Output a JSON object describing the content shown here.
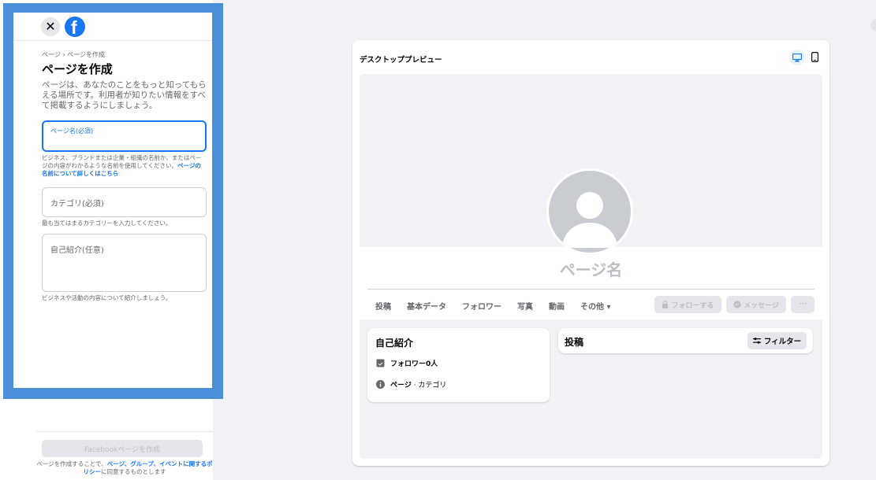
{
  "left_panel": {
    "close_glyph": "✕",
    "logo_letter": "f",
    "breadcrumb": "ページ › ページを作成",
    "title": "ページを作成",
    "description": "ページは、あなたのことをもっと知ってもらえる場所です。利用者が知りたい情報をすべて掲載するようにしましょう。",
    "page_name_field": {
      "label": "ページ名(必須)",
      "value": ""
    },
    "page_name_help": "ビジネス、ブランドまたは企業・組織の名前か、またはページの内容がわかるような名前を使用してください。",
    "page_name_help_link": "ページの名前について詳しくはこちら",
    "category_field": {
      "placeholder": "カテゴリ(必須)"
    },
    "category_help": "最も当てはまるカテゴリーを入力してください。",
    "bio_field": {
      "placeholder": "自己紹介(任意)"
    },
    "bio_help": "ビジネスや活動の内容について紹介しましょう。",
    "create_button": "Facebookページを作成",
    "terms_prefix": "ページを作成することで、",
    "terms_link": "ページ、グループ、イベントに関するポリシー",
    "terms_suffix": "に同意するものとします"
  },
  "preview": {
    "title": "デスクトッププレビュー",
    "page_name": "ページ名",
    "tabs": [
      "投稿",
      "基本データ",
      "フォロワー",
      "写真",
      "動画",
      "その他 ▾"
    ],
    "follow_button": "フォローする",
    "message_button": "メッセージ",
    "more_button": "···",
    "about": {
      "title": "自己紹介",
      "followers": "フォロワー0人",
      "info_bold": "ページ",
      "info_rest": " · カテゴリ"
    },
    "posts": {
      "title": "投稿",
      "filter_button": "フィルター"
    }
  },
  "colors": {
    "accent": "#1877f2",
    "highlight_border": "#4a90d9",
    "disabled_text": "#bcc0c4"
  },
  "icons": [
    "close-icon",
    "facebook-logo-icon",
    "desktop-icon",
    "mobile-icon",
    "lock-icon",
    "messenger-icon",
    "follower-icon",
    "info-icon",
    "filter-icon"
  ]
}
